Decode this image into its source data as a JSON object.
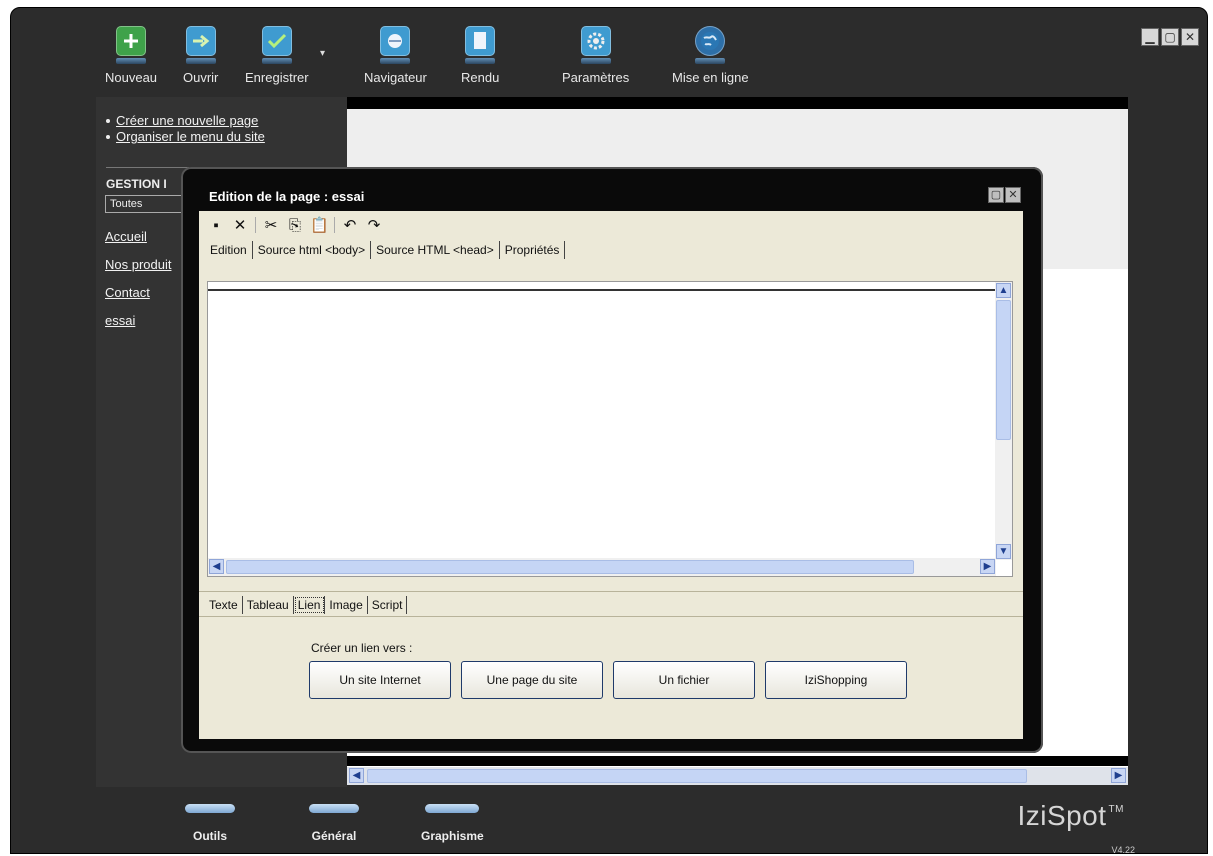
{
  "toolbar": {
    "items": [
      {
        "label": "Nouveau",
        "icon": "plus-icon"
      },
      {
        "label": "Ouvrir",
        "icon": "arrow-right-icon"
      },
      {
        "label": "Enregistrer",
        "icon": "checkmark-icon"
      },
      {
        "label": "Navigateur",
        "icon": "browser-icon"
      },
      {
        "label": "Rendu",
        "icon": "page-icon"
      },
      {
        "label": "Paramètres",
        "icon": "gear-icon"
      },
      {
        "label": "Mise en ligne",
        "icon": "globe-icon"
      }
    ]
  },
  "sidebar": {
    "actions": [
      "Créer une nouvelle page",
      "Organiser le menu du site"
    ],
    "section_title": "GESTION I",
    "filter_value": "Toutes",
    "pages": [
      "Accueil",
      "Nos produit",
      "Contact",
      "essai"
    ]
  },
  "dialog": {
    "title": "Edition de la page : essai",
    "tabs": [
      "Edition",
      "Source html <body>",
      "Source HTML <head>",
      "Propriétés"
    ],
    "bottom_tabs": [
      "Texte",
      "Tableau",
      "Lien",
      "Image",
      "Script"
    ],
    "active_bottom_tab": "Lien",
    "link_label": "Créer un lien vers :",
    "link_buttons": [
      "Un site Internet",
      "Une page du site",
      "Un fichier",
      "IziShopping"
    ]
  },
  "bottom_nav": [
    "Outils",
    "Général",
    "Graphisme"
  ],
  "brand": {
    "name": "IziSpot",
    "tm": "TM",
    "version": "V4.22"
  },
  "colors": {
    "app_bg": "#2c2c2c",
    "dialog_bg": "#ece9d8",
    "scroll_thumb": "#c5d5f5"
  }
}
